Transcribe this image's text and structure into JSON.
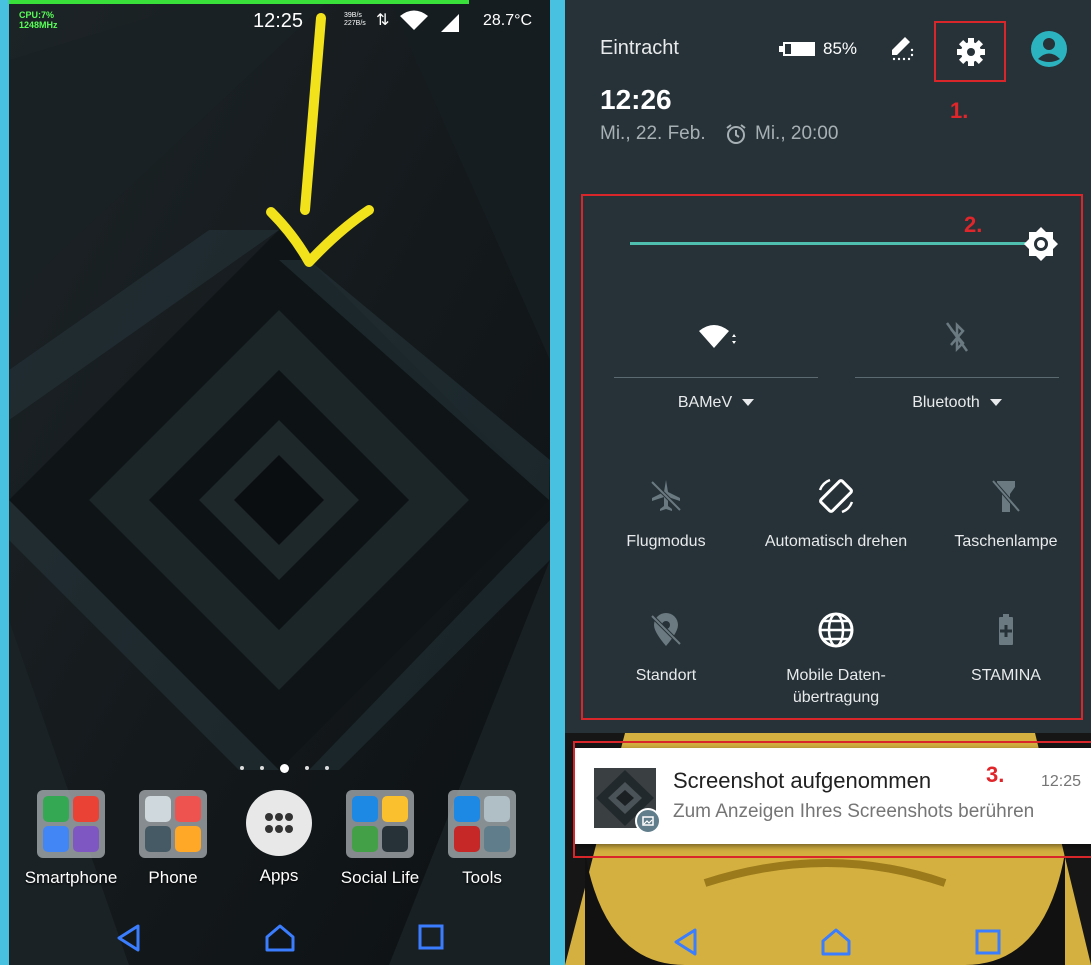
{
  "left_phone": {
    "status_bar": {
      "cpu": "CPU:7%",
      "cpu_freq": "1248MHz",
      "time": "12:25",
      "net_up": "39B/s",
      "net_down": "227B/s",
      "temperature": "28.7°C"
    },
    "page_dots": 5,
    "active_page": 3,
    "dock": [
      {
        "label": "Smartphone",
        "icon": "folder-icon"
      },
      {
        "label": "Phone",
        "icon": "folder-icon"
      },
      {
        "label": "Apps",
        "icon": "app-drawer-icon"
      },
      {
        "label": "Social Life",
        "icon": "folder-icon"
      },
      {
        "label": "Tools",
        "icon": "folder-icon"
      }
    ],
    "nav": [
      "back-icon",
      "home-icon",
      "recents-icon"
    ]
  },
  "right_phone": {
    "header": {
      "carrier": "Eintracht",
      "battery": "85%",
      "time": "12:26",
      "date": "Mi., 22. Feb.",
      "alarm": "Mi., 20:00"
    },
    "marks": {
      "one": "1.",
      "two": "2.",
      "three": "3."
    },
    "brightness": 1.0,
    "tiles_top": [
      {
        "label": "BAMeV",
        "icon": "wifi-icon"
      },
      {
        "label": "Bluetooth",
        "icon": "bluetooth-off-icon"
      }
    ],
    "tiles": [
      {
        "label": "Flugmodus",
        "icon": "airplane-icon"
      },
      {
        "label": "Automatisch drehen",
        "icon": "auto-rotate-icon"
      },
      {
        "label": "Taschenlampe",
        "icon": "flashlight-icon"
      },
      {
        "label": "Standort",
        "icon": "location-off-icon"
      },
      {
        "label": "Mobile Daten-übertragung",
        "label_line1": "Mobile Daten-",
        "label_line2": "übertragung",
        "icon": "globe-icon"
      },
      {
        "label": "STAMINA",
        "icon": "battery-saver-icon"
      }
    ],
    "notification": {
      "title": "Screenshot aufgenommen",
      "time": "12:25",
      "text": "Zum Anzeigen Ihres Screenshots berühren"
    }
  },
  "colors": {
    "accent_teal": "#4fbfb0",
    "annotation_red": "#d9262a",
    "annotation_yellow": "#f2e21c",
    "panel_bg": "#263238",
    "frame_blue": "#48c0e0"
  }
}
